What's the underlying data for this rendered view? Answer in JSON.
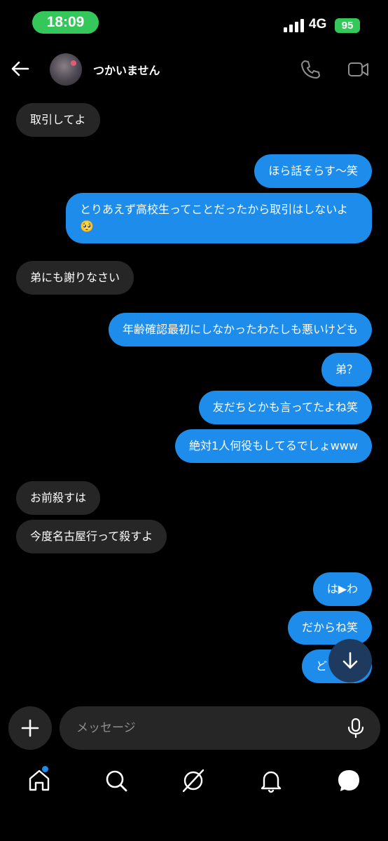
{
  "status": {
    "time": "18:09",
    "network": "4G",
    "battery": "95"
  },
  "header": {
    "contact_name": "つかいません",
    "icons": [
      "back-arrow-icon",
      "phone-icon",
      "video-icon"
    ]
  },
  "messages": [
    {
      "dir": "in",
      "text": "取引してよ"
    },
    {
      "dir": "out",
      "text": "ほら話そらす〜笑"
    },
    {
      "dir": "out",
      "text": "とりあえず高校生ってことだったから取引はしないよ🥺"
    },
    {
      "dir": "in",
      "text": "弟にも謝りなさい"
    },
    {
      "dir": "out",
      "text": "年齢確認最初にしなかったわたしも悪いけども"
    },
    {
      "dir": "out",
      "text": "弟？"
    },
    {
      "dir": "out",
      "text": "友だちとかも言ってたよね笑"
    },
    {
      "dir": "out",
      "text": "絶対1人何役もしてるでしょwww"
    },
    {
      "dir": "in",
      "text": "お前殺すは"
    },
    {
      "dir": "in",
      "text": "今度名古屋行って殺すよ"
    },
    {
      "dir": "out",
      "text": "は▶わ"
    },
    {
      "dir": "out",
      "text": "だからね笑"
    },
    {
      "dir": "out",
      "text": "ど"
    }
  ],
  "composer": {
    "placeholder": "メッセージ"
  },
  "nav": {
    "items": [
      "home-icon",
      "search-icon",
      "explore-icon",
      "notifications-icon",
      "messages-icon"
    ]
  },
  "colors": {
    "outgoing": "#1d8ceb",
    "incoming": "#262626",
    "status_green": "#34c759"
  }
}
